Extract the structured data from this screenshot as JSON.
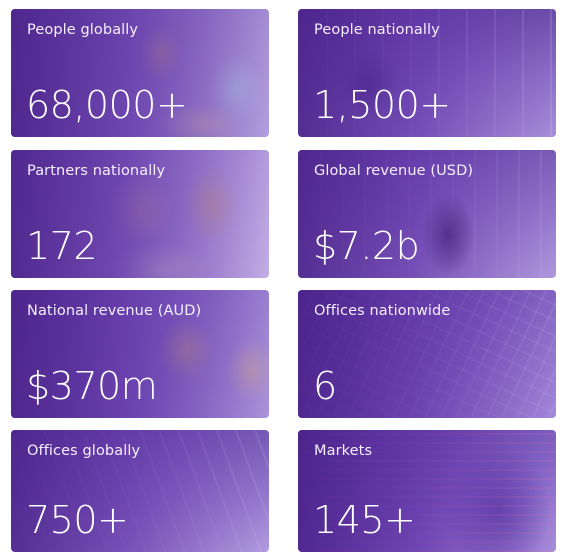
{
  "stats": [
    {
      "label": "People globally",
      "value": "68,000+"
    },
    {
      "label": "People nationally",
      "value": "1,500+"
    },
    {
      "label": "Partners nationally",
      "value": "172"
    },
    {
      "label": "Global revenue (USD)",
      "value": "$7.2b"
    },
    {
      "label": "National revenue (AUD)",
      "value": "$370m"
    },
    {
      "label": "Offices nationwide",
      "value": "6"
    },
    {
      "label": "Offices globally",
      "value": "750+"
    },
    {
      "label": "Markets",
      "value": "145+"
    }
  ],
  "colors": {
    "overlay_primary": "#4c238c",
    "text": "#ffffff"
  }
}
